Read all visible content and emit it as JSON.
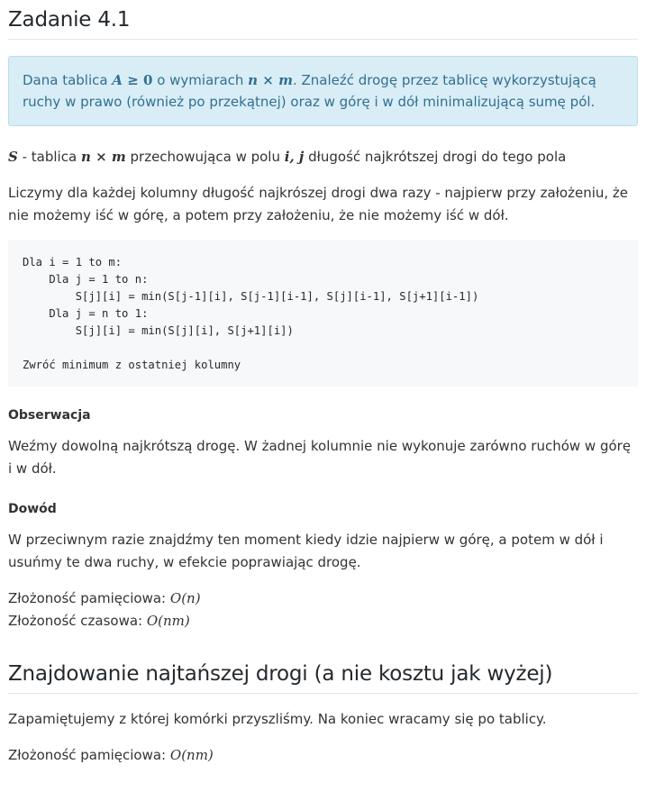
{
  "title1": "Zadanie 4.1",
  "info": {
    "t1": "Dana tablica ",
    "m1": "A",
    "m1b": " ≥ 0",
    "t2": " o wymiarach ",
    "m2": "n × m",
    "t3": ". Znaleźć drogę przez tablicę wykorzystującą ruchy w prawo (również po przekątnej) oraz w górę i w dół minimalizującą sumę pól."
  },
  "p1": {
    "m1": "S",
    "t1": " - tablica ",
    "m2": "n × m",
    "t2": " przechowująca w polu ",
    "m3": "i, j",
    "t3": " długość najkrótszej drogi do tego pola"
  },
  "p2": "Liczymy dla każdej kolumny długość najkrószej drogi dwa razy - najpierw przy założeniu, że nie możemy iść w górę, a potem przy założeniu, że nie możemy iść w dół.",
  "code": "Dla i = 1 to m:\n    Dla j = 1 to n:\n        S[j][i] = min(S[j-1][i], S[j-1][i-1], S[j][i-1], S[j+1][i-1])\n    Dla j = n to 1:\n        S[j][i] = min(S[j][i], S[j+1][i])\n\nZwróć minimum z ostatniej kolumny",
  "h_obs": "Obserwacja",
  "p_obs": "Weźmy dowolną najkrótszą drogę. W żadnej kolumnie nie wykonuje zarówno ruchów w górę i w dół.",
  "h_dow": "Dowód",
  "p_dow": "W przeciwnym razie znajdźmy ten moment kiedy idzie najpierw w górę, a potem w dół i usuńmy te dwa ruchy, w efekcie poprawiając drogę.",
  "mem1_label": "Złożoność pamięciowa: ",
  "mem1_val": "O(n)",
  "time1_label": "Złożoność czasowa: ",
  "time1_val": "O(nm)",
  "title2": "Znajdowanie najtańszej drogi (a nie kosztu jak wyżej)",
  "p3": "Zapamiętujemy z której komórki przyszliśmy. Na koniec wracamy się po tablicy.",
  "mem2_label": "Złożoność pamięciowa: ",
  "mem2_val": "O(nm)"
}
